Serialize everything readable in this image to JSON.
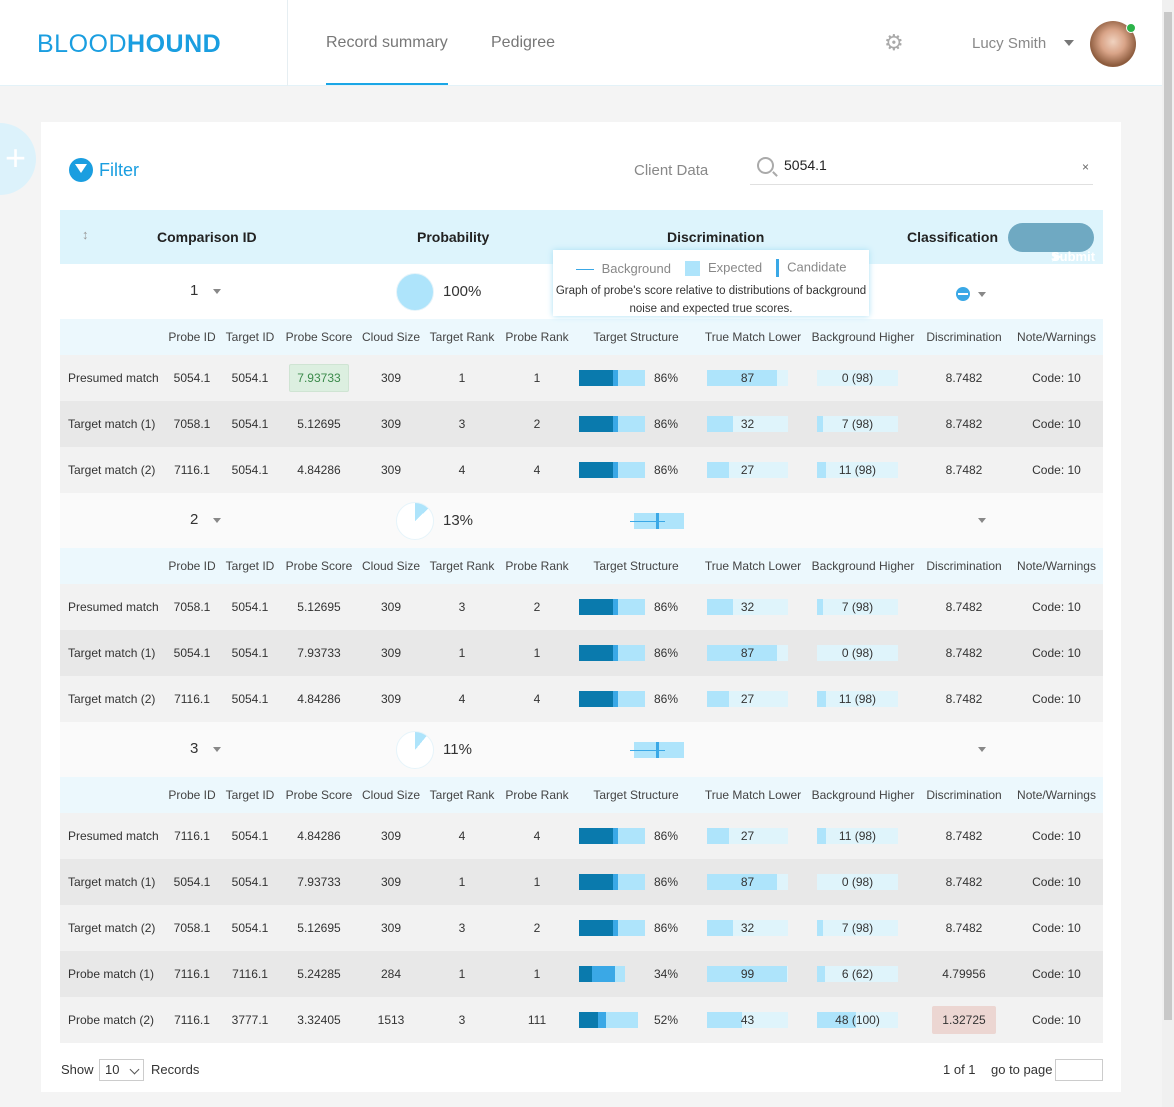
{
  "header": {
    "logo_light": "BLOOD",
    "logo_bold": "HOUND",
    "tabs": [
      {
        "label": "Record summary",
        "active": true
      },
      {
        "label": "Pedigree"
      }
    ],
    "user_name": "Lucy Smith"
  },
  "filter": {
    "label": "Filter",
    "client_data_label": "Client Data",
    "search_value": "5054.1",
    "clear": "×"
  },
  "table": {
    "headers": {
      "comparison_id": "Comparison ID",
      "probability": "Probability",
      "discrimination": "Discrimination",
      "classification": "Classification"
    },
    "submit_label": "Submit",
    "sub_headers": [
      "Probe ID",
      "Target ID",
      "Probe Score",
      "Cloud Size",
      "Target Rank",
      "Probe Rank",
      "Target Structure",
      "True Match Lower",
      "Background Higher",
      "Discrimination",
      "Note/Warnings"
    ],
    "tooltip": {
      "legend": [
        "Background",
        "Expected",
        "Candidate"
      ],
      "text": "Graph of probe's score relative to distributions of background noise and expected true scores."
    },
    "groups": [
      {
        "id": "1",
        "probability": "100%",
        "prob_value": 1.0,
        "rows": [
          {
            "label": "Presumed match",
            "probe": "5054.1",
            "target": "5054.1",
            "score": "7.93733",
            "score_highlight": true,
            "cloud": "309",
            "trank": "1",
            "prank": "1",
            "ts": 86,
            "ts_pct": "86%",
            "tml": "87",
            "bh": "0 (98)",
            "bh_v": 0,
            "bh_t": 98,
            "disc": "8.7482",
            "note": "Code: 10"
          },
          {
            "label": "Target match (1)",
            "probe": "7058.1",
            "target": "5054.1",
            "score": "5.12695",
            "cloud": "309",
            "trank": "3",
            "prank": "2",
            "ts": 86,
            "ts_pct": "86%",
            "tml": "32",
            "bh": "7 (98)",
            "bh_v": 7,
            "bh_t": 98,
            "disc": "8.7482",
            "note": "Code: 10"
          },
          {
            "label": "Target match (2)",
            "probe": "7116.1",
            "target": "5054.1",
            "score": "4.84286",
            "cloud": "309",
            "trank": "4",
            "prank": "4",
            "ts": 86,
            "ts_pct": "86%",
            "tml": "27",
            "bh": "11 (98)",
            "bh_v": 11,
            "bh_t": 98,
            "disc": "8.7482",
            "note": "Code: 10"
          }
        ]
      },
      {
        "id": "2",
        "probability": "13%",
        "prob_value": 0.13,
        "rows": [
          {
            "label": "Presumed match",
            "probe": "7058.1",
            "target": "5054.1",
            "score": "5.12695",
            "cloud": "309",
            "trank": "3",
            "prank": "2",
            "ts": 86,
            "ts_pct": "86%",
            "tml": "32",
            "bh": "7 (98)",
            "bh_v": 7,
            "bh_t": 98,
            "disc": "8.7482",
            "note": "Code: 10"
          },
          {
            "label": "Target match (1)",
            "probe": "5054.1",
            "target": "5054.1",
            "score": "7.93733",
            "cloud": "309",
            "trank": "1",
            "prank": "1",
            "ts": 86,
            "ts_pct": "86%",
            "tml": "87",
            "bh": "0 (98)",
            "bh_v": 0,
            "bh_t": 98,
            "disc": "8.7482",
            "note": "Code: 10"
          },
          {
            "label": "Target match (2)",
            "probe": "7116.1",
            "target": "5054.1",
            "score": "4.84286",
            "cloud": "309",
            "trank": "4",
            "prank": "4",
            "ts": 86,
            "ts_pct": "86%",
            "tml": "27",
            "bh": "11 (98)",
            "bh_v": 11,
            "bh_t": 98,
            "disc": "8.7482",
            "note": "Code: 10"
          }
        ]
      },
      {
        "id": "3",
        "probability": "11%",
        "prob_value": 0.11,
        "rows": [
          {
            "label": "Presumed match",
            "probe": "7116.1",
            "target": "5054.1",
            "score": "4.84286",
            "cloud": "309",
            "trank": "4",
            "prank": "4",
            "ts": 86,
            "ts_pct": "86%",
            "tml": "27",
            "bh": "11 (98)",
            "bh_v": 11,
            "bh_t": 98,
            "disc": "8.7482",
            "note": "Code: 10"
          },
          {
            "label": "Target match (1)",
            "probe": "5054.1",
            "target": "5054.1",
            "score": "7.93733",
            "cloud": "309",
            "trank": "1",
            "prank": "1",
            "ts": 86,
            "ts_pct": "86%",
            "tml": "87",
            "bh": "0 (98)",
            "bh_v": 0,
            "bh_t": 98,
            "disc": "8.7482",
            "note": "Code: 10"
          },
          {
            "label": "Target match (2)",
            "probe": "7058.1",
            "target": "5054.1",
            "score": "5.12695",
            "cloud": "309",
            "trank": "3",
            "prank": "2",
            "ts": 86,
            "ts_pct": "86%",
            "tml": "32",
            "bh": "7 (98)",
            "bh_v": 7,
            "bh_t": 98,
            "disc": "8.7482",
            "note": "Code: 10"
          },
          {
            "label": "Probe match (1)",
            "probe": "7116.1",
            "target": "7116.1",
            "score": "5.24285",
            "cloud": "284",
            "trank": "1",
            "prank": "1",
            "ts": 34,
            "ts_pct": "34%",
            "tml": "99",
            "bh": "6 (62)",
            "bh_v": 6,
            "bh_t": 62,
            "disc": "4.79956",
            "note": "Code: 10"
          },
          {
            "label": "Probe match (2)",
            "probe": "7116.1",
            "target": "3777.1",
            "score": "3.32405",
            "cloud": "1513",
            "trank": "3",
            "prank": "111",
            "ts": 52,
            "ts_pct": "52%",
            "tml": "43",
            "bh": "48 (100)",
            "bh_v": 48,
            "bh_t": 100,
            "disc": "1.32725",
            "disc_highlight": true,
            "note": "Code: 10"
          }
        ]
      }
    ]
  },
  "footer": {
    "show_label": "Show",
    "page_size": "10",
    "records_label": "Records",
    "page_info": "1 of 1",
    "goto_label": "go to page"
  },
  "colors": {
    "accent": "#1a9ee0",
    "header_bg": "#ddf4fc",
    "dark_bar": "#0a7aad",
    "mid_bar": "#3aa8e6",
    "light_bar": "#aee4fb",
    "score_highlight": "#dcefe0",
    "disc_highlight": "#ecd6d2"
  }
}
